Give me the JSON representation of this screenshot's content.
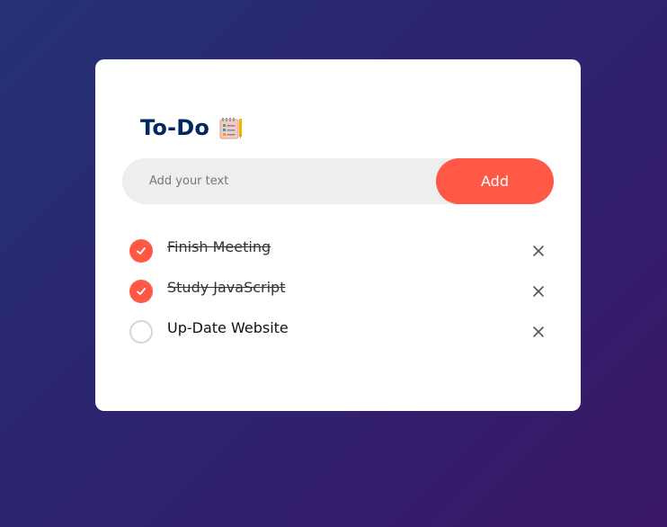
{
  "app": {
    "title": "To-Do",
    "title_icon": "notepad-icon"
  },
  "input": {
    "placeholder": "Add your text",
    "value": ""
  },
  "add_button": {
    "label": "Add"
  },
  "tasks": [
    {
      "label": "Finish Meeting",
      "done": true
    },
    {
      "label": "Study JavaScript",
      "done": true
    },
    {
      "label": "Up-Date Website",
      "done": false
    }
  ],
  "icons": {
    "check": "check-icon",
    "remove": "close-icon"
  },
  "colors": {
    "accent": "#ff5945",
    "title": "#002765",
    "input_bg": "#edeef0",
    "background_start": "#243273",
    "background_end": "#3a1766"
  }
}
